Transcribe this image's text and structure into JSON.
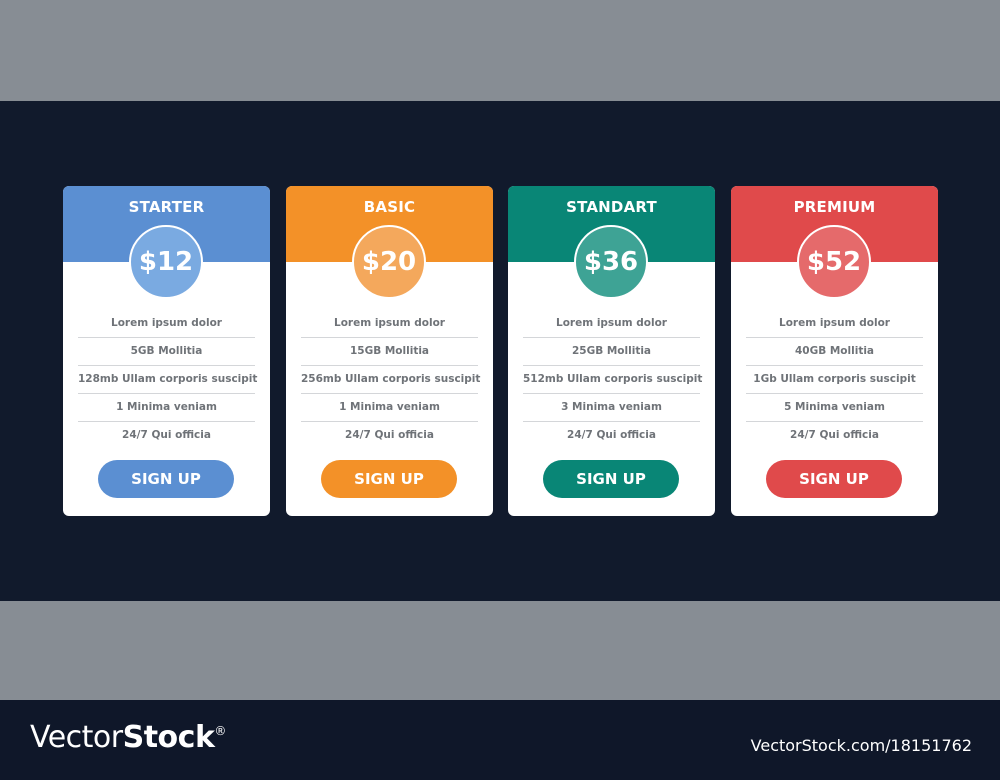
{
  "plans": [
    {
      "name": "STARTER",
      "price": "$12",
      "header_color": "#5b8fd2",
      "circle_color": "#7aaae1",
      "button_color": "#5b8fd2",
      "features": [
        "Lorem ipsum dolor",
        "5GB Mollitia",
        "128mb Ullam corporis suscipit",
        "1 Minima veniam",
        "24/7 Qui officia"
      ],
      "button_label": "SIGN UP"
    },
    {
      "name": "BASIC",
      "price": "$20",
      "header_color": "#f39128",
      "circle_color": "#f4a85c",
      "button_color": "#f39128",
      "features": [
        "Lorem ipsum dolor",
        "15GB Mollitia",
        "256mb Ullam corporis suscipit",
        "1 Minima veniam",
        "24/7 Qui officia"
      ],
      "button_label": "SIGN UP"
    },
    {
      "name": "STANDART",
      "price": "$36",
      "header_color": "#098676",
      "circle_color": "#3ea395",
      "button_color": "#098676",
      "features": [
        "Lorem ipsum dolor",
        "25GB Mollitia",
        "512mb Ullam corporis suscipit",
        "3 Minima veniam",
        "24/7 Qui officia"
      ],
      "button_label": "SIGN UP"
    },
    {
      "name": "PREMIUM",
      "price": "$52",
      "header_color": "#e04a4b",
      "circle_color": "#e56a6b",
      "button_color": "#e04a4b",
      "features": [
        "Lorem ipsum dolor",
        "40GB Mollitia",
        "1Gb Ullam corporis suscipit",
        "5 Minima veniam",
        "24/7 Qui officia"
      ],
      "button_label": "SIGN UP"
    }
  ],
  "footer": {
    "logo_light": "Vector",
    "logo_bold": "Stock",
    "logo_reg": "®",
    "image_id": "VectorStock.com/18151762"
  }
}
